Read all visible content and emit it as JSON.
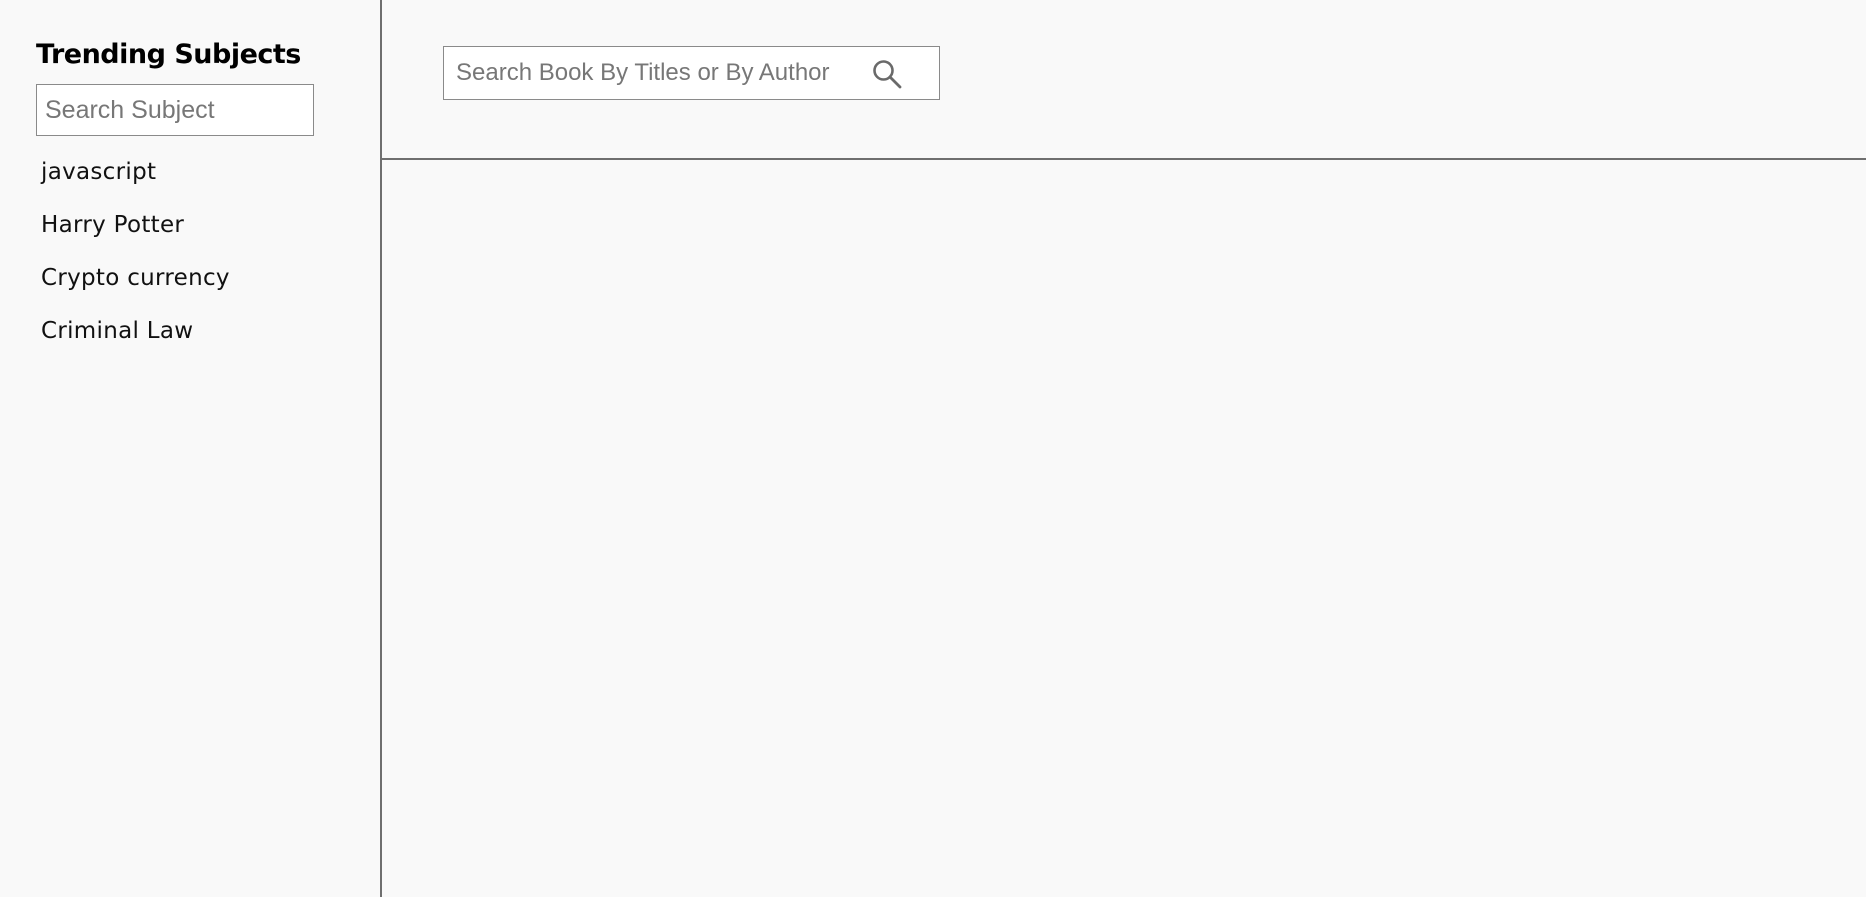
{
  "sidebar": {
    "title": "Trending Subjects",
    "search_placeholder": "Search Subject",
    "subjects": [
      {
        "label": "javascript"
      },
      {
        "label": "Harry Potter"
      },
      {
        "label": "Crypto currency"
      },
      {
        "label": "Criminal Law"
      }
    ]
  },
  "header": {
    "search_placeholder": "Search Book By Titles or By Author",
    "search_icon": "search-icon"
  },
  "colors": {
    "background": "#f9f9f9",
    "divider": "#6f6f6f",
    "input_border": "#8a8a8a"
  }
}
